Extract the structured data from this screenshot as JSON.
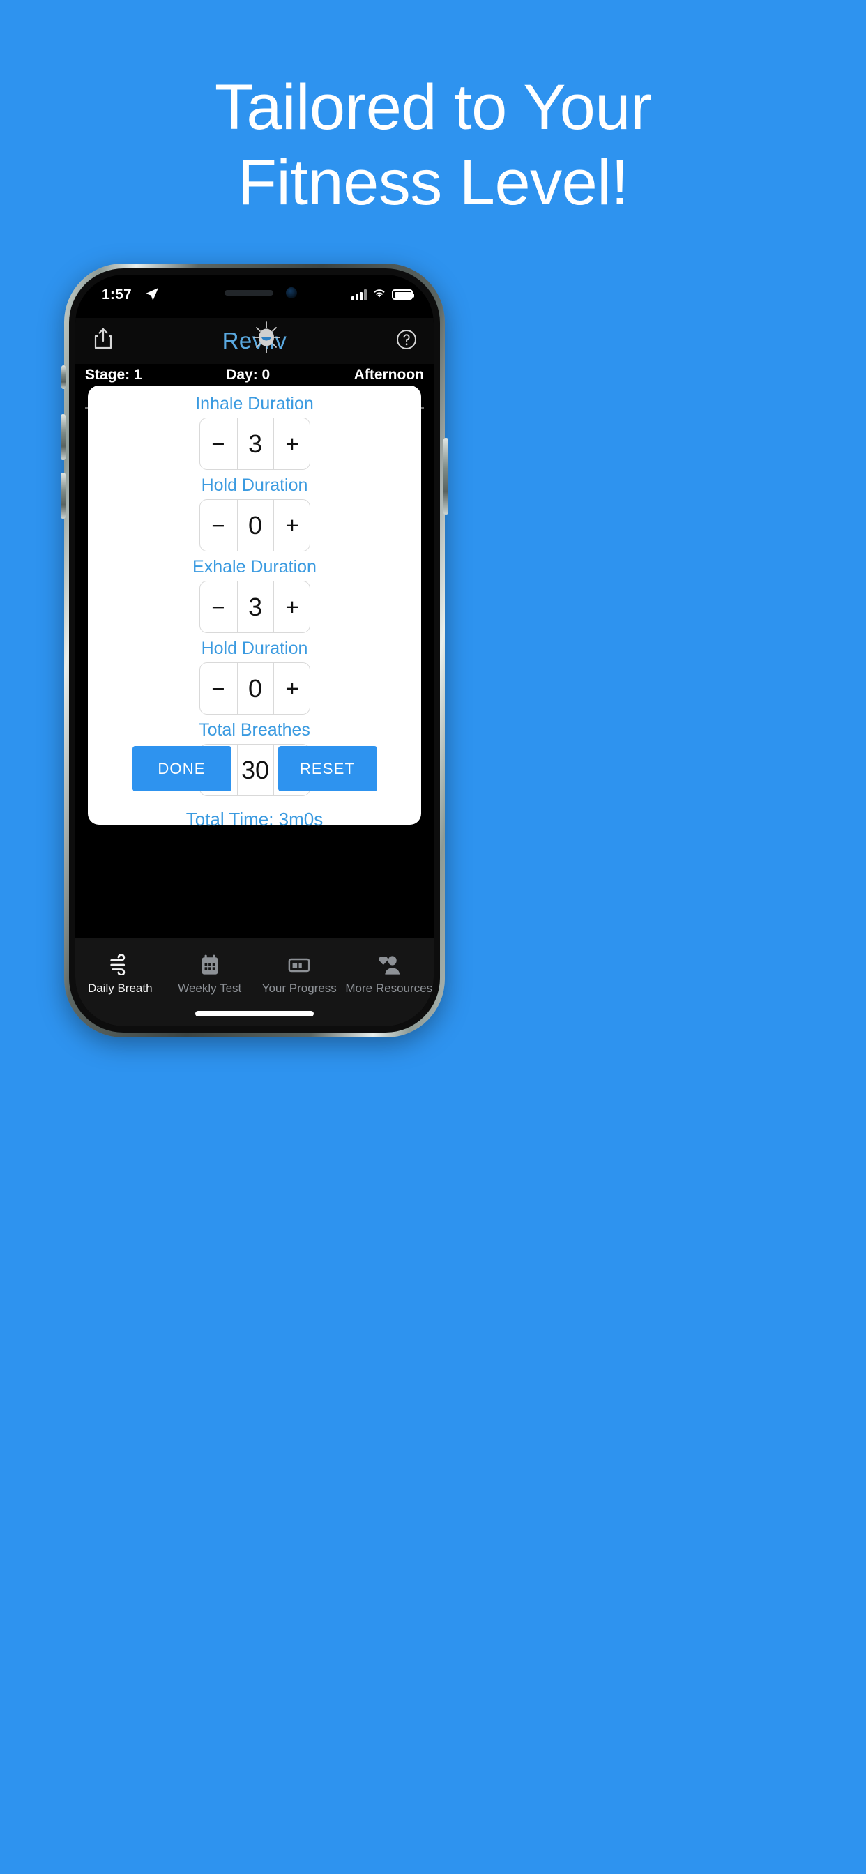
{
  "promo": {
    "line1": "Tailored to Your",
    "line2": "Fitness Level!",
    "background_color": "#2e93ef"
  },
  "status_bar": {
    "time": "1:57",
    "location_icon": "location-arrow-icon",
    "signal_icon": "cellular-signal-icon",
    "wifi_icon": "wifi-icon",
    "battery_icon": "battery-icon"
  },
  "app_bar": {
    "share_icon": "share-icon",
    "help_icon": "question-mark-circle-icon",
    "brand": "Reviiv",
    "logo_icon": "sun-smiley-icon",
    "brand_color": "#5aa9e0"
  },
  "stage_row": {
    "stage": "Stage: 1",
    "day": "Day: 0",
    "period": "Afternoon"
  },
  "sheet": {
    "fields": [
      {
        "label": "Inhale Duration",
        "minus": "−",
        "value": "3",
        "plus": "+"
      },
      {
        "label": "Hold Duration",
        "minus": "−",
        "value": "0",
        "plus": "+"
      },
      {
        "label": "Exhale Duration",
        "minus": "−",
        "value": "3",
        "plus": "+"
      },
      {
        "label": "Hold Duration",
        "minus": "−",
        "value": "0",
        "plus": "+"
      },
      {
        "label": "Total Breathes",
        "minus": "−",
        "value": "30",
        "plus": "+"
      }
    ],
    "total_time": "Total Time: 3m0s",
    "done_label": "DONE",
    "reset_label": "RESET",
    "accent_color": "#3a9ae0",
    "button_color": "#2e93ef"
  },
  "tab_bar": {
    "items": [
      {
        "label": "Daily Breath",
        "icon": "wind-icon",
        "active": true
      },
      {
        "label": "Weekly Test",
        "icon": "calendar-icon",
        "active": false
      },
      {
        "label": "Your Progress",
        "icon": "chart-card-icon",
        "active": false
      },
      {
        "label": "More Resources",
        "icon": "people-heart-icon",
        "active": false
      }
    ]
  }
}
